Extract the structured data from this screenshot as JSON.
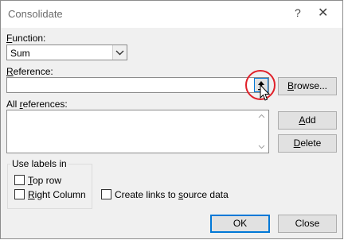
{
  "window": {
    "title": "Consolidate",
    "help_glyph": "?",
    "close_glyph": "✕"
  },
  "function": {
    "label_prefix": "F",
    "label_rest": "unction:",
    "value": "Sum"
  },
  "reference": {
    "label_prefix": "R",
    "label_rest": "eference:",
    "value": ""
  },
  "all_references": {
    "label_before": "All ",
    "label_underlined": "r",
    "label_after": "eferences:",
    "items": []
  },
  "buttons": {
    "browse_u": "B",
    "browse_rest": "rowse...",
    "add_u": "A",
    "add_rest": "dd",
    "delete_u": "D",
    "delete_rest": "elete",
    "ok": "OK",
    "close": "Close"
  },
  "use_labels": {
    "legend": "Use labels in",
    "top_row_u": "T",
    "top_row_rest": "op row",
    "top_row_checked": false,
    "left_column_u": "R",
    "left_column_rest": "ight Column",
    "left_column_checked": false
  },
  "create_links": {
    "label_before": "Create links to ",
    "label_underlined": "s",
    "label_after": "ource data",
    "checked": false
  },
  "annotation_color": "#e0212a"
}
